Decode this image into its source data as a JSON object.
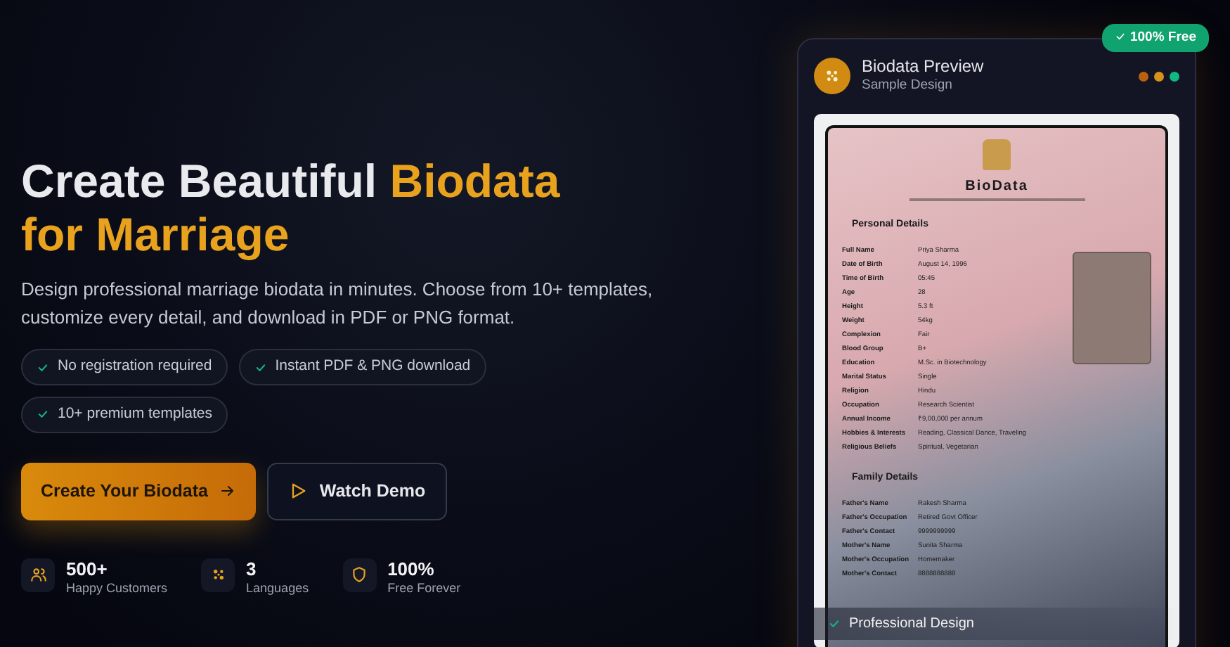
{
  "hero": {
    "title_plain": "Create Beautiful ",
    "title_accent": "Biodata",
    "title_line2": "for Marriage",
    "description": "Design professional marriage biodata in minutes. Choose from 10+ templates, customize every detail, and download in PDF or PNG format.",
    "features": [
      "No registration required",
      "Instant PDF & PNG download",
      "10+ premium templates"
    ],
    "buttons": [
      {
        "kind": "primary",
        "label": "Create Your Biodata"
      },
      {
        "kind": "outline",
        "label": "Watch Demo"
      }
    ],
    "stats": [
      {
        "kind": "people",
        "value": "500+",
        "label": "Happy Customers"
      },
      {
        "kind": "languages",
        "value": "3",
        "label": "Languages"
      },
      {
        "kind": "shield",
        "value": "100%",
        "label": "Free Forever"
      }
    ]
  },
  "preview": {
    "badge": "100% Free",
    "title": "Biodata Preview",
    "subtitle": "Sample Design",
    "dots": [
      {
        "color": "#b8620f"
      },
      {
        "color": "#d4921a"
      },
      {
        "color": "#10b981"
      }
    ],
    "document": {
      "heading": "BioData",
      "sections": [
        {
          "title": "Personal Details",
          "rows": [
            {
              "label": "Full Name",
              "value": "Priya Sharma"
            },
            {
              "label": "Date of Birth",
              "value": "August 14, 1996"
            },
            {
              "label": "Time of Birth",
              "value": "05:45"
            },
            {
              "label": "Age",
              "value": "28"
            },
            {
              "label": "Height",
              "value": "5.3 ft"
            },
            {
              "label": "Weight",
              "value": "54kg"
            },
            {
              "label": "Complexion",
              "value": "Fair"
            },
            {
              "label": "Blood Group",
              "value": "B+"
            },
            {
              "label": "Education",
              "value": "M.Sc. in Biotechnology"
            },
            {
              "label": "Marital Status",
              "value": "Single"
            },
            {
              "label": "Religion",
              "value": "Hindu"
            },
            {
              "label": "Occupation",
              "value": "Research Scientist"
            },
            {
              "label": "Annual Income",
              "value": "₹9,00,000 per annum"
            },
            {
              "label": "Hobbies & Interests",
              "value": "Reading, Classical Dance, Traveling"
            },
            {
              "label": "Religious Beliefs",
              "value": "Spiritual, Vegetarian"
            }
          ]
        },
        {
          "title": "Family Details",
          "rows": [
            {
              "label": "Father's Name",
              "value": "Rakesh Sharma"
            },
            {
              "label": "Father's Occupation",
              "value": "Retired Govt Officer"
            },
            {
              "label": "Father's Contact",
              "value": "9999999999"
            },
            {
              "label": "Mother's Name",
              "value": "Sunita Sharma"
            },
            {
              "label": "Mother's Occupation",
              "value": "Homemaker"
            },
            {
              "label": "Mother's Contact",
              "value": "8888888888"
            }
          ]
        }
      ]
    },
    "caption": "Professional Design"
  }
}
